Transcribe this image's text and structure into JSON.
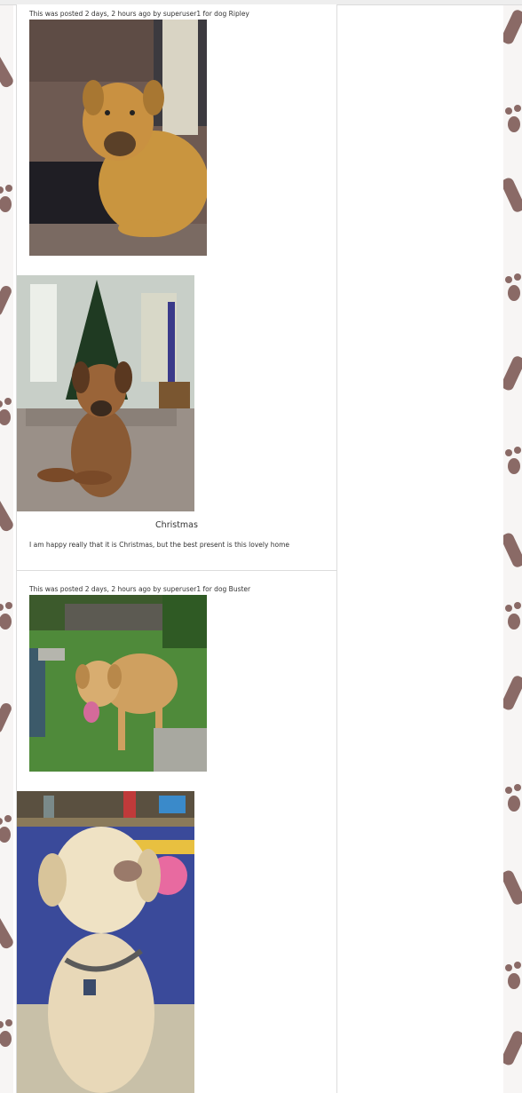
{
  "posts": [
    {
      "meta": "This was posted 2 days, 2 hours ago by superuser1 for dog Ripley",
      "photo_1_desc": "ripley-on-sofa-photo",
      "photo_2_desc": "ripley-christmas-photo",
      "title": "Christmas",
      "body": "I am happy really that it is Christmas, but the best present is this lovely home"
    },
    {
      "meta": "This was posted 2 days, 2 hours ago by superuser1 for dog Buster",
      "photo_1_desc": "buster-on-lawn-photo",
      "photo_2_desc": "buster-indoors-photo"
    }
  ],
  "background": {
    "pattern": "paw-print-icon",
    "paw_color": "#8a6a66",
    "strip_color": "#f7f5f4"
  }
}
